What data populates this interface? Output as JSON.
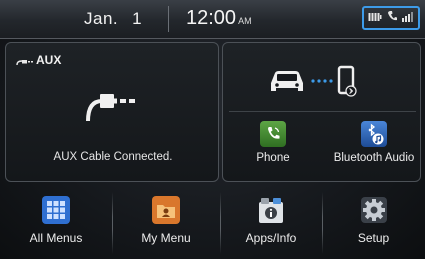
{
  "status_bar": {
    "date_month": "Jan.",
    "date_day": "1",
    "time": "12:00",
    "ampm": "AM",
    "icons": [
      "battery-icon",
      "call-signal-icon",
      "network-signal-icon"
    ]
  },
  "aux_panel": {
    "title": "AUX",
    "title_icon": "aux-plug-icon",
    "main_icon": "aux-cable-icon",
    "status": "AUX Cable Connected."
  },
  "bluetooth_panel": {
    "graphic": [
      "car-icon",
      "connection-dots-icon",
      "bluetooth-phone-icon"
    ],
    "tiles": [
      {
        "label": "Phone",
        "icon": "phone-app-icon",
        "color": "#3f8a2e"
      },
      {
        "label": "Bluetooth Audio",
        "icon": "bluetooth-audio-icon",
        "color": "#2a5fae"
      }
    ]
  },
  "bottom_menu": [
    {
      "label": "All Menus",
      "icon": "all-menus-grid-icon",
      "color": "#2f6fd1"
    },
    {
      "label": "My Menu",
      "icon": "my-menu-folder-icon",
      "color": "#d9772c"
    },
    {
      "label": "Apps/Info",
      "icon": "apps-info-icon",
      "color": "#c9cdd2"
    },
    {
      "label": "Setup",
      "icon": "setup-gear-icon",
      "color": "#aab3bd"
    }
  ],
  "colors": {
    "accent_highlight": "#3d9be9",
    "background": "#15181c",
    "panel_border": "#4c5157"
  }
}
